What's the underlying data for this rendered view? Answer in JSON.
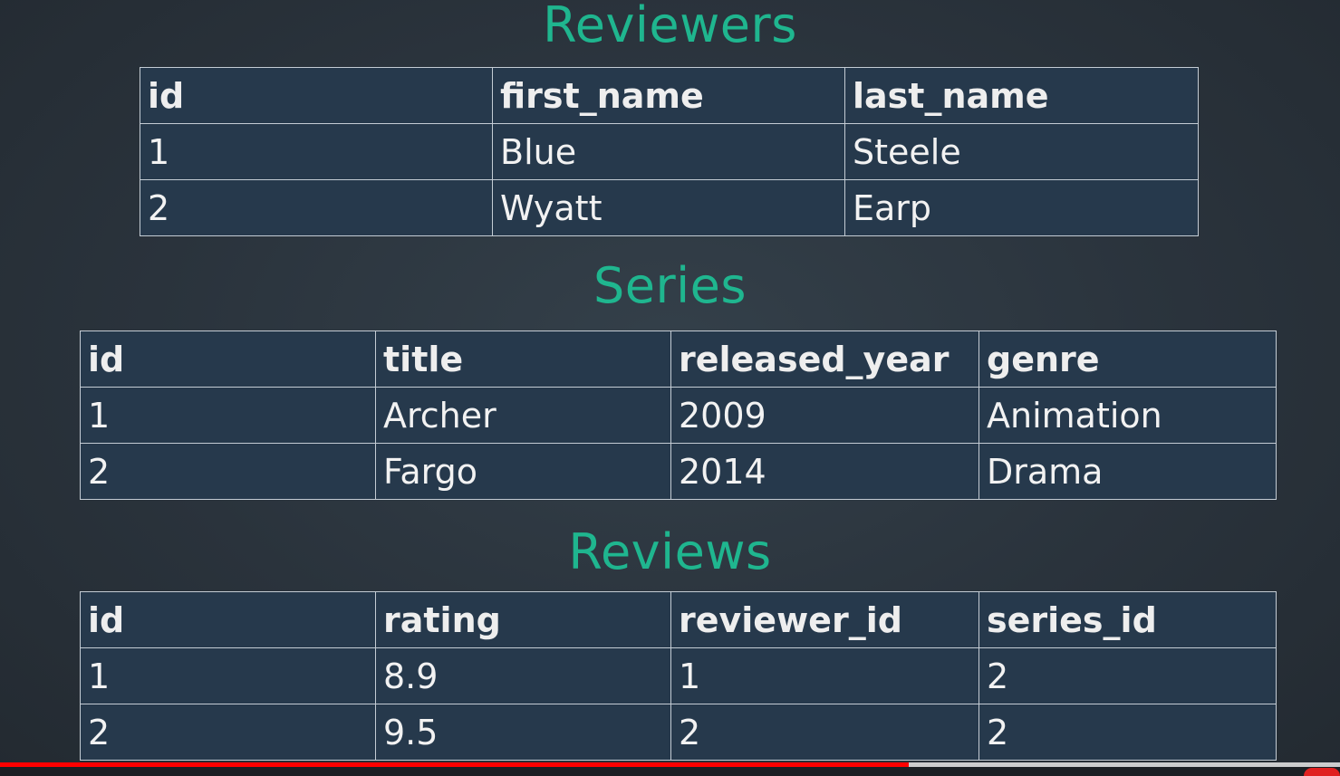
{
  "reviewers": {
    "title": "Reviewers",
    "columns": [
      "id",
      "first_name",
      "last_name"
    ],
    "rows": [
      [
        "1",
        "Blue",
        "Steele"
      ],
      [
        "2",
        "Wyatt",
        "Earp"
      ]
    ]
  },
  "series": {
    "title": "Series",
    "columns": [
      "id",
      "title",
      "released_year",
      "genre"
    ],
    "rows": [
      [
        "1",
        "Archer",
        "2009",
        "Animation"
      ],
      [
        "2",
        "Fargo",
        "2014",
        "Drama"
      ]
    ]
  },
  "reviews": {
    "title": "Reviews",
    "columns": [
      "id",
      "rating",
      "reviewer_id",
      "series_id"
    ],
    "rows": [
      [
        "1",
        "8.9",
        "1",
        "2"
      ],
      [
        "2",
        "9.5",
        "2",
        "2"
      ]
    ]
  },
  "player": {
    "progress_fraction": 0.678,
    "buffered_fraction": 1.0,
    "accent_color": "#ff0000"
  },
  "colors": {
    "title": "#1fb68f",
    "table_bg": "#26394c",
    "border": "#c4ccd4"
  }
}
